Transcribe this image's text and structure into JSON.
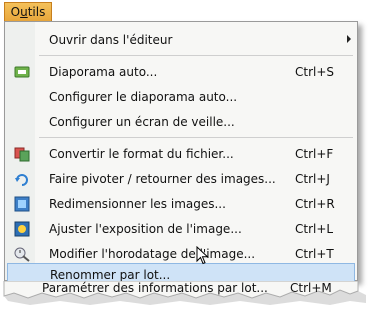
{
  "menubar": {
    "tab_prefix": "O",
    "tab_mnemonic": "u",
    "tab_suffix": "tils"
  },
  "menu": {
    "items": [
      {
        "label": "Ouvrir dans l'éditeur",
        "shortcut": "",
        "icon": "none",
        "submenu": true
      },
      {
        "label": "Diaporama auto...",
        "shortcut": "Ctrl+S",
        "icon": "slideshow-icon"
      },
      {
        "label": "Configurer le diaporama auto...",
        "shortcut": "",
        "icon": "none"
      },
      {
        "label": "Configurer un écran de veille...",
        "shortcut": "",
        "icon": "none"
      },
      {
        "label": "Convertir le format du fichier...",
        "shortcut": "Ctrl+F",
        "icon": "convert-icon"
      },
      {
        "label": "Faire pivoter / retourner des images...",
        "shortcut": "Ctrl+J",
        "icon": "rotate-icon"
      },
      {
        "label": "Redimensionner les images...",
        "shortcut": "Ctrl+R",
        "icon": "resize-icon"
      },
      {
        "label": "Ajuster l'exposition de l'image...",
        "shortcut": "Ctrl+L",
        "icon": "exposure-icon"
      },
      {
        "label": "Modifier l'horodatage de l'image...",
        "shortcut": "Ctrl+T",
        "icon": "timestamp-icon"
      },
      {
        "label": "Renommer par lot...",
        "shortcut": "",
        "icon": "none",
        "highlighted": true
      },
      {
        "label": "Paramétrer des informations par lot...",
        "shortcut": "Ctrl+M",
        "icon": "none"
      }
    ]
  }
}
